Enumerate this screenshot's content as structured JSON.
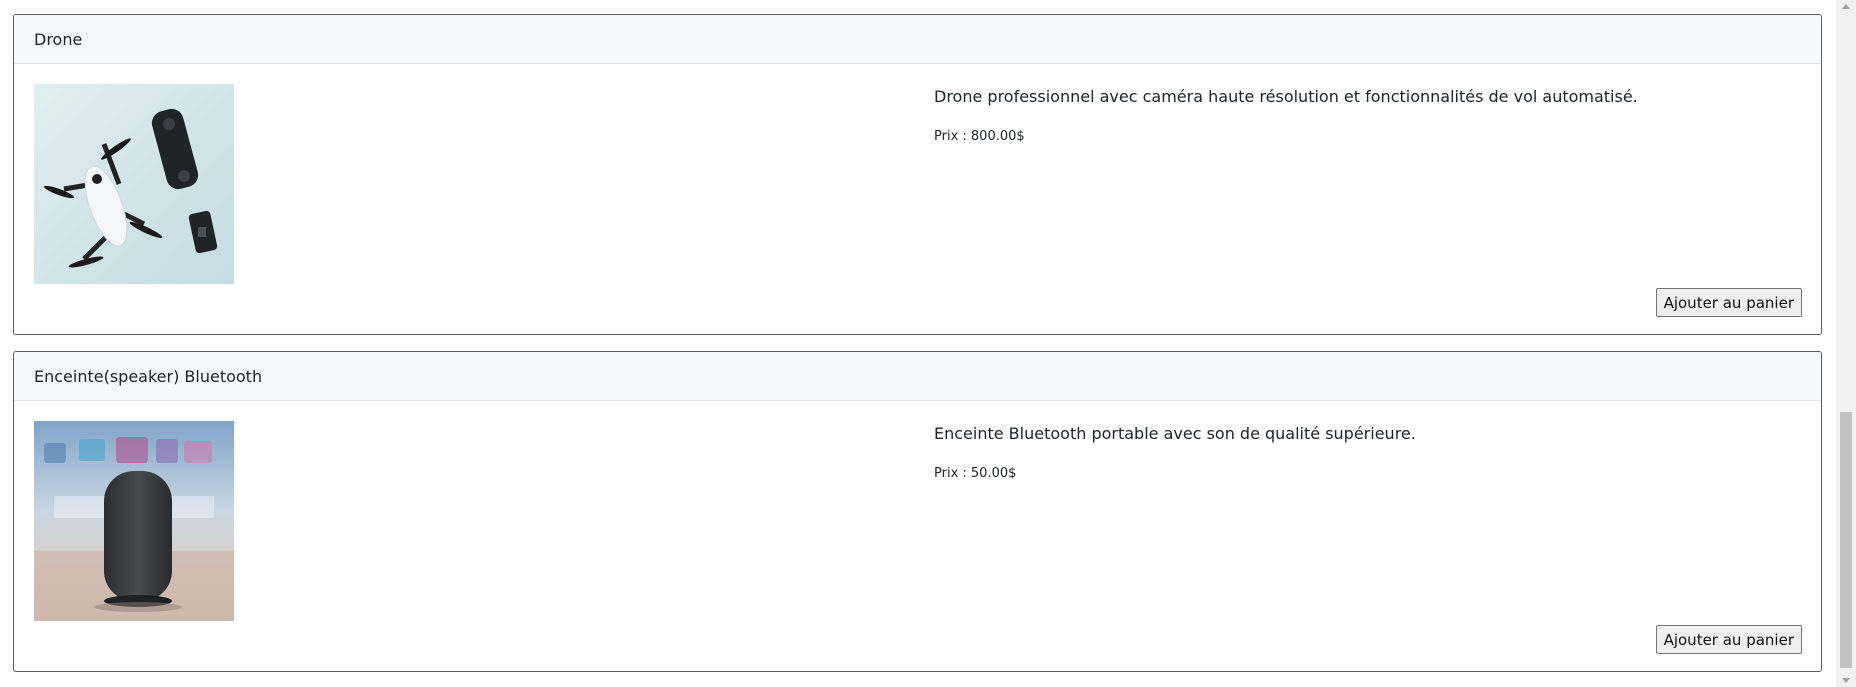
{
  "products": [
    {
      "title": "Drone",
      "description": "Drone professionnel avec caméra haute résolution et fonctionnalités de vol automatisé.",
      "price": "Prix : 800.00$",
      "button_label": "Ajouter au panier",
      "image_icon": "drone-image"
    },
    {
      "title": "Enceinte(speaker) Bluetooth",
      "description": "Enceinte Bluetooth portable avec son de qualité supérieure.",
      "price": "Prix : 50.00$",
      "button_label": "Ajouter au panier",
      "image_icon": "speaker-image"
    }
  ],
  "colors": {
    "card_border": "#5a5a5a",
    "header_bg": "#f7f8f9",
    "text": "#212529",
    "button_bg": "#efefef"
  }
}
